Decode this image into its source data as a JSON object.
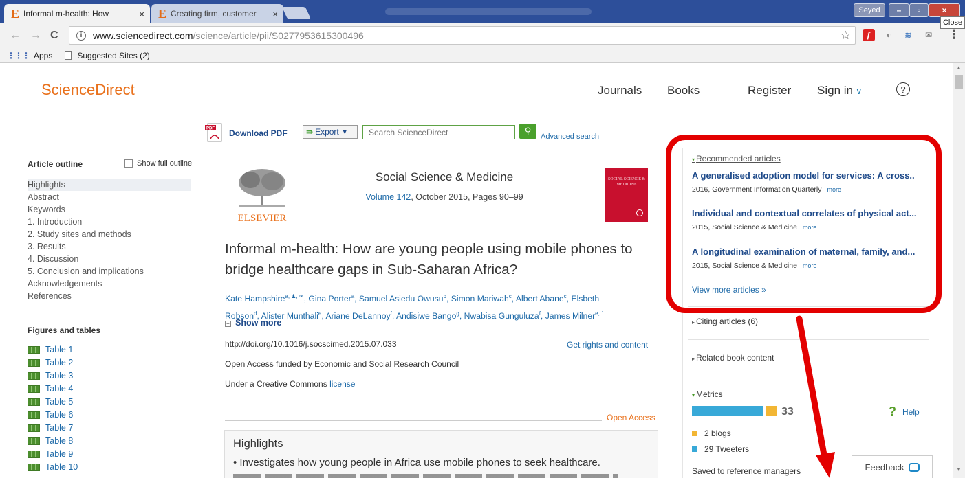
{
  "browser": {
    "tabs": [
      {
        "favicon": "E",
        "title": "Informal m-health: How",
        "close": "×"
      },
      {
        "favicon": "E",
        "title": "Creating firm, customer",
        "close": "×"
      }
    ],
    "profile": "Seyed",
    "window": {
      "minimize": "–",
      "maximize": "▫",
      "close": "×",
      "close_tooltip": "Close"
    },
    "nav": {
      "back": "←",
      "forward": "→",
      "reload": "C",
      "info": "i"
    },
    "url_host": "www.sciencedirect.com",
    "url_path": "/science/article/pii/S0277953615300496",
    "star": "☆",
    "menu": "⋮",
    "bookmarks": {
      "apps": "Apps",
      "suggested": "Suggested Sites (2)"
    }
  },
  "site": {
    "logo": "ScienceDirect",
    "nav": {
      "journals": "Journals",
      "books": "Books",
      "register": "Register",
      "sign_in": "Sign in",
      "chevron": "∨",
      "help": "?"
    }
  },
  "actions": {
    "download_pdf": "Download PDF",
    "pdf_badge": "PDF",
    "export": "Export",
    "search_placeholder": "Search ScienceDirect",
    "search_btn": "🔍",
    "advanced_search": "Advanced search"
  },
  "outline": {
    "title": "Article outline",
    "show_full": "Show full outline",
    "items": [
      "Highlights",
      "Abstract",
      "Keywords",
      "1. Introduction",
      "2. Study sites and methods",
      "3. Results",
      "4. Discussion",
      "5. Conclusion and implications",
      "Acknowledgements",
      "References"
    ],
    "figures_title": "Figures and tables",
    "tables": [
      "Table 1",
      "Table 2",
      "Table 3",
      "Table 4",
      "Table 5",
      "Table 6",
      "Table 7",
      "Table 8",
      "Table 9",
      "Table 10"
    ]
  },
  "article": {
    "publisher": "ELSEVIER",
    "journal": "Social Science & Medicine",
    "volume_link": "Volume 142",
    "volume_rest": ", October 2015, Pages 90–99",
    "cover_text": "SOCIAL SCIENCE & MEDICINE",
    "title": "Informal m-health: How are young people using mobile phones to bridge healthcare gaps in Sub-Saharan Africa?",
    "authors_line1": "Kate Hampshire",
    "authors_line1_rest": ", Gina Porter",
    "authors_line1_b": ", Samuel Asiedu Owusu",
    "authors_line1_c": ", Simon Mariwah",
    "authors_line1_d": ", Albert Abane",
    "authors_line1_e": ", Elsbeth",
    "authors_line2": "Robson",
    "authors_line2_b": ", Alister Munthali",
    "authors_line2_c": ", Ariane DeLannoy",
    "authors_line2_d": ", Andisiwe Bango",
    "authors_line2_e": ", Nwabisa Gunguluza",
    "authors_line2_f": ", James Milner",
    "sup": {
      "a": "a",
      "b": "b",
      "c": "c",
      "d": "d",
      "e": "e",
      "f": "f",
      "g": "g",
      "a1": "a, 1",
      "amark": "a, ♟, ✉",
      "e1": "e, 1"
    },
    "show_more": "Show more",
    "show_more_icon": "+",
    "doi": "http://doi.org/10.1016/j.socscimed.2015.07.033",
    "rights": "Get rights and content",
    "funding": "Open Access funded by Economic and Social Research Council",
    "cc_prefix": "Under a Creative Commons ",
    "cc_link": "license",
    "open_access": "Open Access",
    "highlights_title": "Highlights",
    "highlight_1": "• Investigates how young people in Africa use mobile phones to seek healthcare."
  },
  "sidebar": {
    "recommended_title": "Recommended articles",
    "recommended": [
      {
        "title": "A generalised adoption model for services: A cross..",
        "meta": "2016, Government Information Quarterly",
        "more": "more"
      },
      {
        "title": "Individual and contextual correlates of physical act...",
        "meta": "2015, Social Science & Medicine",
        "more": "more"
      },
      {
        "title": "A longitudinal examination of maternal, family, and...",
        "meta": "2015, Social Science & Medicine",
        "more": "more"
      }
    ],
    "view_more": "View more articles »",
    "citing": "Citing articles (6)",
    "related": "Related book content",
    "metrics": "Metrics",
    "metric_score": "33",
    "help": "Help",
    "help_icon": "?",
    "blogs": "2 blogs",
    "tweeters": "29 Tweeters",
    "saved": "Saved to reference managers",
    "feedback": "Feedback",
    "tri_open": "▾",
    "tri_closed": "▸"
  },
  "colors": {
    "accent": "#e9711c",
    "link": "#1e6aa8",
    "annotation": "#e30000",
    "metric_blue": "#38a9d8",
    "metric_yellow": "#f2b634"
  }
}
